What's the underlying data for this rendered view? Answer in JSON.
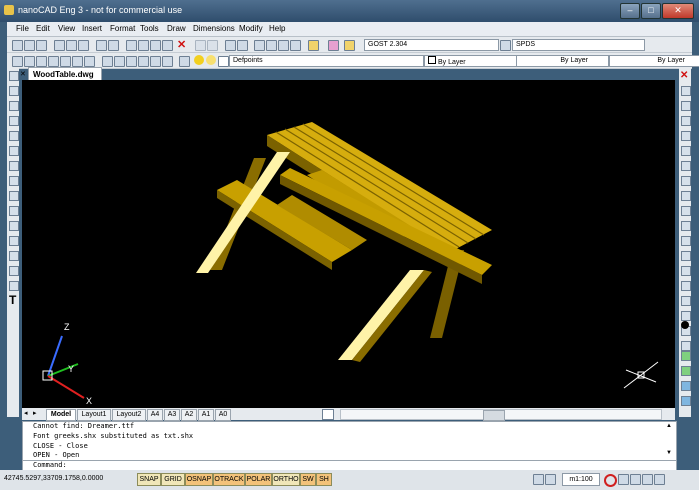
{
  "window": {
    "title": "nanoCAD Eng 3 - not for commercial use",
    "minimize": "–",
    "maximize": "□",
    "close": "✕"
  },
  "menu": [
    "File",
    "Edit",
    "View",
    "Insert",
    "Format",
    "Tools",
    "Draw",
    "Dimensions",
    "Modify",
    "Help"
  ],
  "toolbar": {
    "text_style": "GOST 2.304",
    "dim_style": "SPDS",
    "layer": "Defpoints",
    "color": "By Layer",
    "linetype": "By Layer",
    "lineweight": "By Layer"
  },
  "document_tab": "WoodTable.dwg",
  "layout_tabs": [
    "Model",
    "Layout1",
    "Layout2",
    "A4",
    "A3",
    "A2",
    "A1",
    "A0"
  ],
  "axis_labels": {
    "z": "Z",
    "y": "Y",
    "x": "X"
  },
  "command_lines": [
    "Cannot find: Dreamer.ttf",
    "Font greeks.shx substituted as txt.shx",
    "CLOSE - Close",
    "OPEN - Open",
    "Command:"
  ],
  "status": {
    "coords": "42745.5297,33709.1758,0.0000",
    "buttons": [
      "SNAP",
      "GRID",
      "OSNAP",
      "OTRACK",
      "POLAR",
      "ORTHO",
      "SW",
      "SH"
    ],
    "active": [
      "OSNAP",
      "OTRACK",
      "POLAR",
      "SW",
      "SH"
    ],
    "scale": "m1:100"
  },
  "colors": {
    "wood": "#c8a000",
    "wood_dark": "#6b5500",
    "viewport": "#000000"
  }
}
